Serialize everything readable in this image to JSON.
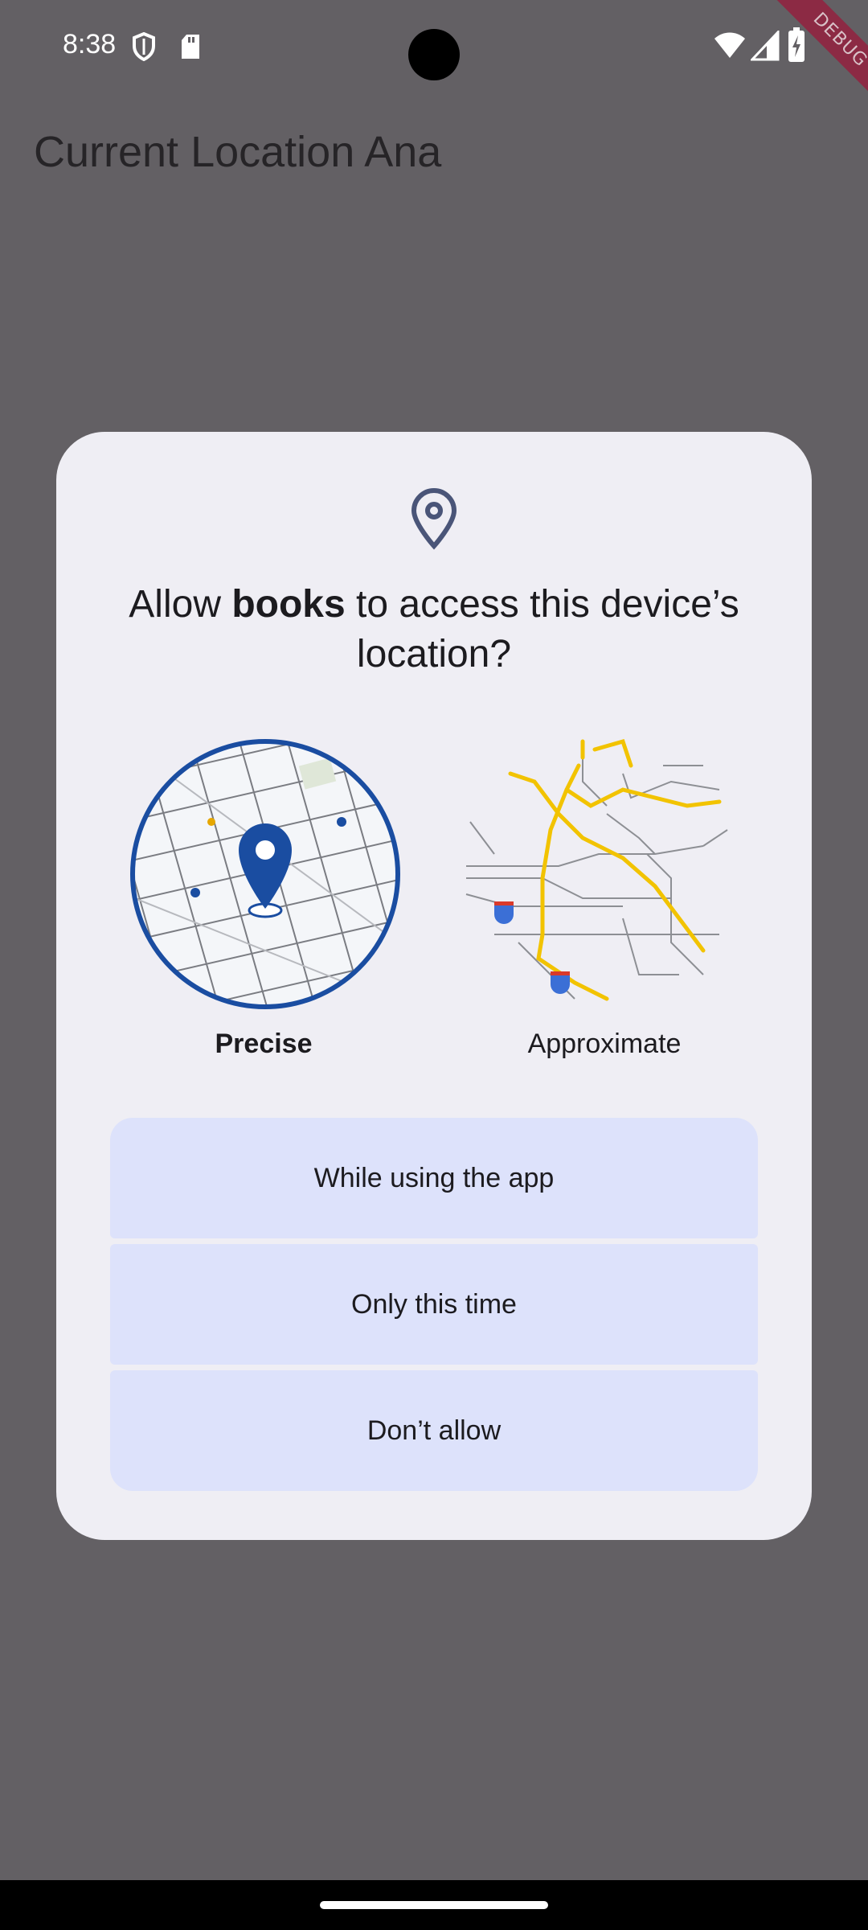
{
  "status_bar": {
    "time": "8:38",
    "icons": [
      "shield-icon",
      "sd-card-icon",
      "wifi-icon",
      "cell-signal-icon",
      "battery-charging-icon"
    ],
    "debug_banner": "DEBUG"
  },
  "app_bar": {
    "title": "Current Location Ana"
  },
  "dialog": {
    "icon": "location-pin-icon",
    "title_prefix": "Allow ",
    "title_app": "books",
    "title_suffix": " to access this device’s location?",
    "options": {
      "precise_label": "Precise",
      "approximate_label": "Approximate",
      "selected": "Precise"
    },
    "buttons": {
      "while_using": "While using the app",
      "only_this_time": "Only this time",
      "dont_allow": "Don’t allow"
    }
  },
  "colors": {
    "scrim": "#636064",
    "dialog_bg": "#efeef4",
    "button_bg": "#dde2fb",
    "accent": "#1a4da1",
    "map_road_yellow": "#f2c300"
  }
}
